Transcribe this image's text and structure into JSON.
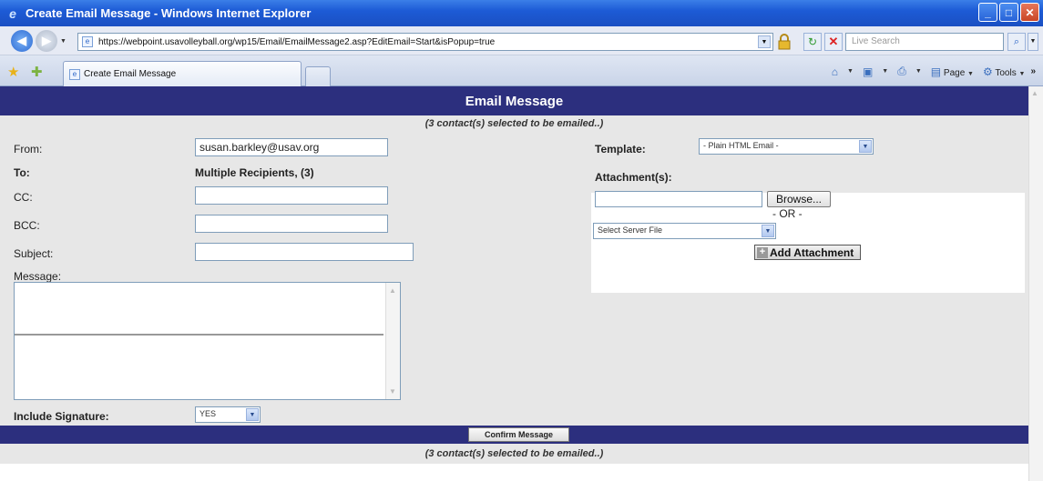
{
  "window": {
    "title": "Create Email Message - Windows Internet Explorer"
  },
  "browser": {
    "url": "https://webpoint.usavolleyball.org/wp15/Email/EmailMessage2.asp?EditEmail=Start&isPopup=true",
    "search_placeholder": "Live Search",
    "tab_title": "Create Email Message",
    "page_menu": "Page",
    "tools_menu": "Tools"
  },
  "page": {
    "header": "Email Message",
    "notice_top": "(3 contact(s) selected to be emailed..)",
    "notice_bottom": "(3 contact(s) selected to be emailed..)"
  },
  "form": {
    "from_label": "From:",
    "from_value": "susan.barkley@usav.org",
    "to_label": "To:",
    "to_value": "Multiple Recipients, (3)",
    "cc_label": "CC:",
    "cc_value": "",
    "bcc_label": "BCC:",
    "bcc_value": "",
    "subject_label": "Subject:",
    "subject_value": "",
    "message_label": "Message:",
    "signature_label": "Include Signature:",
    "signature_value": "YES",
    "template_label": "Template:",
    "template_value": "- Plain HTML Email -",
    "attachments_label": "Attachment(s):",
    "browse_label": "Browse...",
    "or_label": "- OR -",
    "server_file_value": "Select Server File",
    "add_attachment_label": "Add Attachment",
    "confirm_label": "Confirm Message"
  }
}
